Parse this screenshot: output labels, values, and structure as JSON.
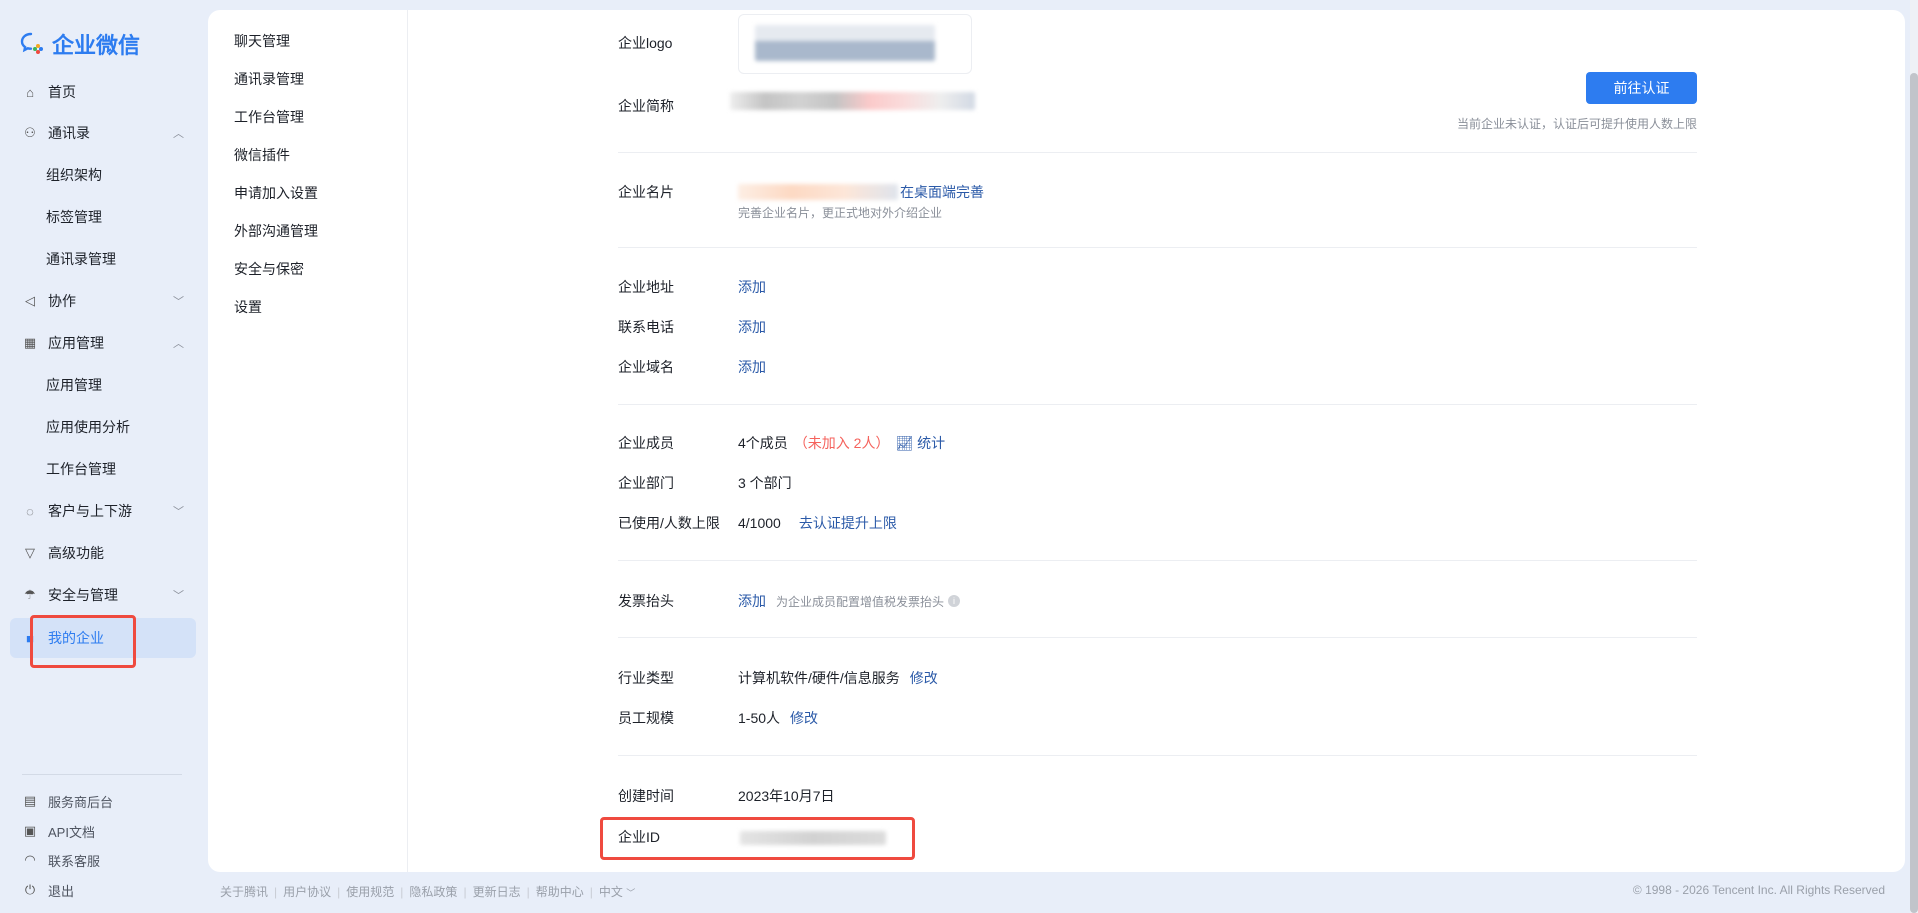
{
  "brand": {
    "name": "企业微信"
  },
  "sidebar": {
    "items": [
      {
        "label": "首页",
        "icon": "home-icon"
      },
      {
        "label": "通讯录",
        "icon": "org-icon",
        "expanded": true
      },
      {
        "label": "组织架构"
      },
      {
        "label": "标签管理"
      },
      {
        "label": "通讯录管理"
      },
      {
        "label": "协作",
        "icon": "collab-icon",
        "expanded": false
      },
      {
        "label": "应用管理",
        "icon": "apps-icon",
        "expanded": true
      },
      {
        "label": "应用管理"
      },
      {
        "label": "应用使用分析"
      },
      {
        "label": "工作台管理"
      },
      {
        "label": "客户与上下游",
        "icon": "chat-icon",
        "expanded": false
      },
      {
        "label": "高级功能",
        "icon": "advanced-icon"
      },
      {
        "label": "安全与管理",
        "icon": "umbrella-icon",
        "expanded": false
      },
      {
        "label": "我的企业",
        "icon": "company-icon",
        "active": true
      }
    ],
    "bottom": [
      {
        "label": "服务商后台",
        "icon": "provider-icon"
      },
      {
        "label": "API文档",
        "icon": "api-icon"
      },
      {
        "label": "联系客服",
        "icon": "headset-icon"
      },
      {
        "label": "退出",
        "icon": "power-icon"
      }
    ]
  },
  "subnav": [
    "聊天管理",
    "通讯录管理",
    "工作台管理",
    "微信插件",
    "申请加入设置",
    "外部沟通管理",
    "安全与保密",
    "设置"
  ],
  "content": {
    "logo_label": "企业logo",
    "short_name_label": "企业简称",
    "verify_button": "前往认证",
    "verify_hint": "当前企业未认证，认证后可提升使用人数上限",
    "card_label": "企业名片",
    "card_link": "在桌面端完善",
    "card_hint": "完善企业名片，更正式地对外介绍企业",
    "address_label": "企业地址",
    "address_action": "添加",
    "phone_label": "联系电话",
    "phone_action": "添加",
    "domain_label": "企业域名",
    "domain_action": "添加",
    "members_label": "企业成员",
    "members_value": "4个成员",
    "members_pending": "（未加入 2人）",
    "members_stats": "统计",
    "depts_label": "企业部门",
    "depts_value": "3 个部门",
    "usage_label": "已使用/人数上限",
    "usage_value": "4/1000",
    "usage_link": "去认证提升上限",
    "invoice_label": "发票抬头",
    "invoice_action": "添加",
    "invoice_hint": "为企业成员配置增值税发票抬头",
    "industry_label": "行业类型",
    "industry_value": "计算机软件/硬件/信息服务",
    "industry_edit": "修改",
    "size_label": "员工规模",
    "size_value": "1-50人",
    "size_edit": "修改",
    "created_label": "创建时间",
    "created_value": "2023年10月7日",
    "id_label": "企业ID"
  },
  "footer": {
    "links": [
      "关于腾讯",
      "用户协议",
      "使用规范",
      "隐私政策",
      "更新日志",
      "帮助中心",
      "中文"
    ],
    "copyright": "© 1998 - 2026 Tencent Inc. All Rights Reserved"
  },
  "colors": {
    "accent": "#2d7cf0",
    "link": "#2b5aa8",
    "warning": "#f5625c",
    "annotation": "#ef4a3f"
  }
}
